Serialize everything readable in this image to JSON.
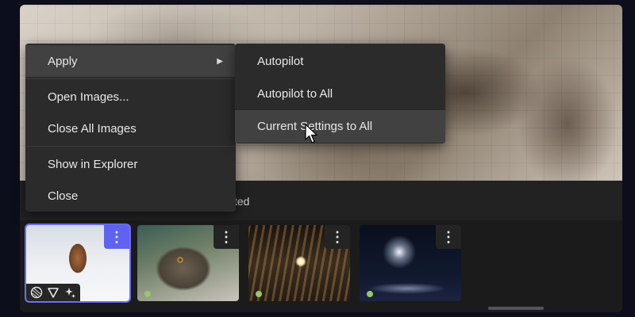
{
  "status": {
    "text": "ted"
  },
  "context_menu": {
    "items": [
      {
        "label": "Apply",
        "has_submenu": true,
        "arrow": "▶"
      },
      {
        "label": "Open Images..."
      },
      {
        "label": "Close All Images"
      },
      {
        "label": "Show in Explorer"
      },
      {
        "label": "Close"
      }
    ]
  },
  "submenu": {
    "items": [
      {
        "label": "Autopilot"
      },
      {
        "label": "Autopilot to All"
      },
      {
        "label": "Current Settings to All"
      }
    ]
  },
  "filmstrip": {
    "thumbnails": [
      {
        "subject": "tiger in snow",
        "selected": true,
        "menu_icon": "⋮"
      },
      {
        "subject": "owl",
        "selected": false,
        "menu_icon": "⋮"
      },
      {
        "subject": "lit building interior",
        "selected": false,
        "menu_icon": "⋮"
      },
      {
        "subject": "fireworks at night",
        "selected": false,
        "menu_icon": "⋮"
      }
    ],
    "badge_icons": [
      "aperture-icon",
      "filter-icon",
      "sparkle-icon"
    ]
  },
  "colors": {
    "accent": "#5f63ef",
    "menu_bg": "#2b2b2b",
    "menu_active": "#414141",
    "status_dot": "#9ac46e"
  }
}
